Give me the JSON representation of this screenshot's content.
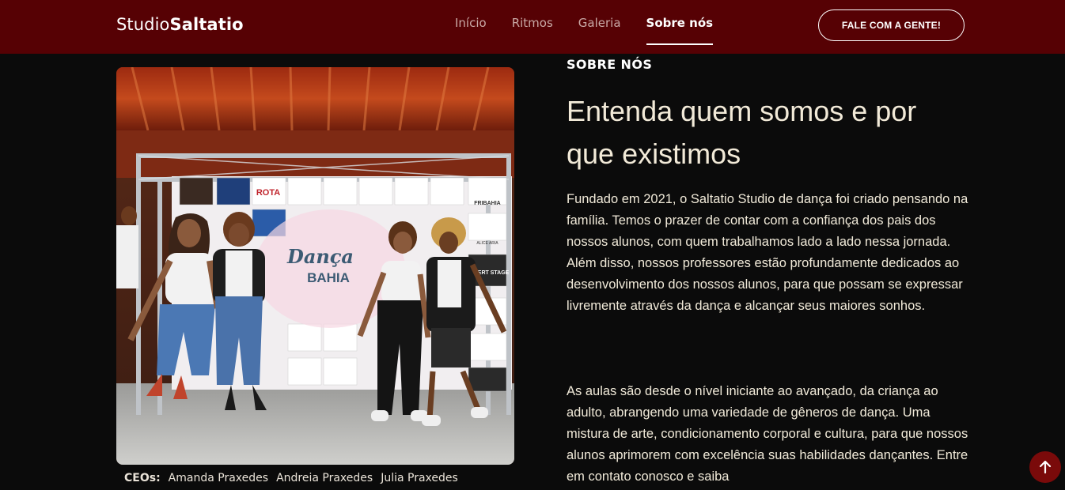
{
  "brand": {
    "logo_light": "Studio",
    "logo_bold": "Saltatio"
  },
  "nav": {
    "items": [
      {
        "label": "Início"
      },
      {
        "label": "Ritmos"
      },
      {
        "label": "Galeria"
      },
      {
        "label": "Sobre nós",
        "active": true
      }
    ],
    "cta_label": "FALE COM A GENTE!"
  },
  "about": {
    "section_label": "SOBRE NÓS",
    "headline": "Entenda quem somos e por que existimos",
    "paragraph_1": "Fundado em 2021, o Saltatio Studio de dança foi criado pensando na família. Temos o prazer de contar com a confiança dos pais dos nossos alunos, com quem trabalhamos lado a lado nessa jornada. Além disso, nossos professores estão profundamente dedicados ao desenvolvimento dos nossos alunos, para que possam se expressar livremente através da dança e alcançar seus maiores sonhos.",
    "paragraph_2": "As aulas são desde o nível iniciante ao avançado, da criança ao adulto, abrangendo uma variedade de gêneros de dança. Uma mistura de arte, condicionamento corporal e cultura, para que nossos alunos aprimorem com excelência suas habilidades dançantes. Entre em contato conosco e saiba"
  },
  "photo": {
    "banner_title": "Dança",
    "banner_subtitle": "BAHIA",
    "sponsor_labels": [
      "ROTA",
      "FRIBAHIA",
      "ALICE ARIA",
      "OUVERT STAGE"
    ]
  },
  "ceos": {
    "label": "CEOs:",
    "names": [
      "Amanda Praxedes",
      "Andreia Praxedes",
      "Julia Praxedes"
    ]
  },
  "colors": {
    "header": "#560104",
    "background": "#0b0b0b",
    "accent": "#7a0a0a"
  },
  "icons": {
    "scroll_top": "arrow-up-icon"
  }
}
